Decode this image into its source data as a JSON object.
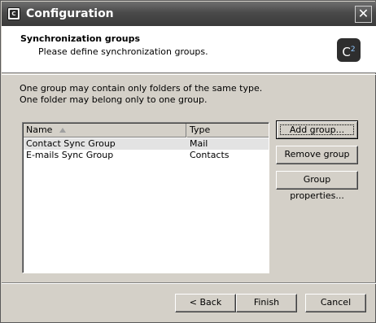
{
  "window": {
    "title": "Configuration",
    "close_glyph": "✕"
  },
  "header": {
    "title": "Synchronization groups",
    "subtitle": "Please define synchronization groups.",
    "logo_text": "C",
    "logo_sup": "2"
  },
  "info": {
    "line1": "One group may contain only folders of the same type.",
    "line2": "One folder may belong only to one group."
  },
  "table": {
    "columns": [
      "Name",
      "Type"
    ],
    "rows": [
      {
        "name": "Contact Sync Group",
        "type": "Mail",
        "selected": true
      },
      {
        "name": "E-mails Sync Group",
        "type": "Contacts",
        "selected": false
      }
    ]
  },
  "actions": {
    "add_group": "Add group...",
    "remove_group": "Remove group",
    "group_properties": "Group properties..."
  },
  "footer": {
    "back": "< Back",
    "finish": "Finish",
    "cancel": "Cancel"
  }
}
